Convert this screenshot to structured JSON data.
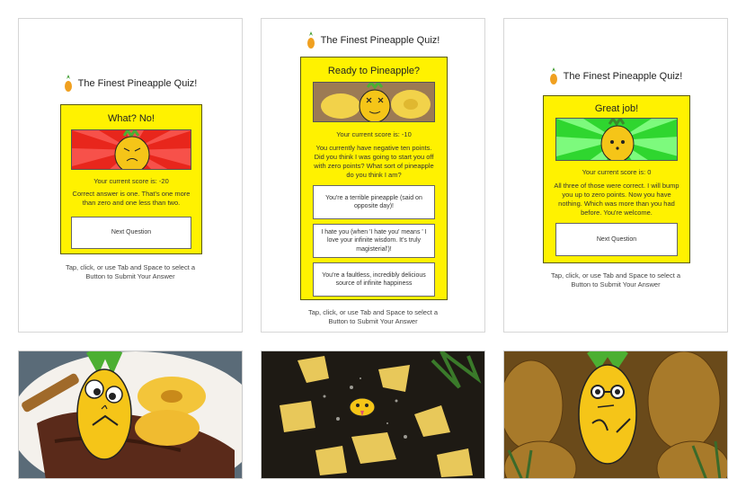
{
  "quiz_title": "The Finest Pineapple Quiz!",
  "instructions_line1": "Tap, click, or use Tab and Space to select a",
  "instructions_line2": "Button to Submit Your Answer",
  "panels": [
    {
      "heading": "What? No!",
      "score": "Your current score is: -20",
      "message": "Correct answer is one. That's one more than zero and one less than two.",
      "buttons": [
        "Next Question"
      ],
      "banner_mood": "angry",
      "banner_color": "#e8261c"
    },
    {
      "heading": "Ready to Pineapple?",
      "score": "Your current score is: -10",
      "message": "You currently have negative ten points. Did you think I was going to start you off with zero points? What sort of pineapple do you think I am?",
      "buttons": [
        "You're a terrible pineapple (said on opposite day)!",
        "I hate you (when 'I hate you' means ' I love your infinite wisdom. It's truly magisterial')!",
        "You're a faultless, incredibly delicious source of infinite happiness"
      ],
      "banner_mood": "dazed",
      "banner_color": "#8a6a4a"
    },
    {
      "heading": "Great job!",
      "score": "Your current score is: 0",
      "message": "All three of those were correct. I will bump you up to zero points. Now you have nothing. Which was more than you had before. You're welcome.",
      "buttons": [
        "Next Question"
      ],
      "banner_mood": "neutral",
      "banner_color": "#2fd62f"
    }
  ],
  "photos": [
    {
      "scene": "grilled pineapple with steak on a plate",
      "mascot": "googly-eyed pineapple"
    },
    {
      "scene": "exploding pineapple pieces on dark background",
      "mascot": "tongue-out pineapple"
    },
    {
      "scene": "pile of whole pineapples",
      "mascot": "pineapple with glasses"
    }
  ],
  "colors": {
    "card_yellow": "#fff200",
    "pineapple_body": "#f5c518",
    "pineapple_leaf": "#4caf32"
  }
}
